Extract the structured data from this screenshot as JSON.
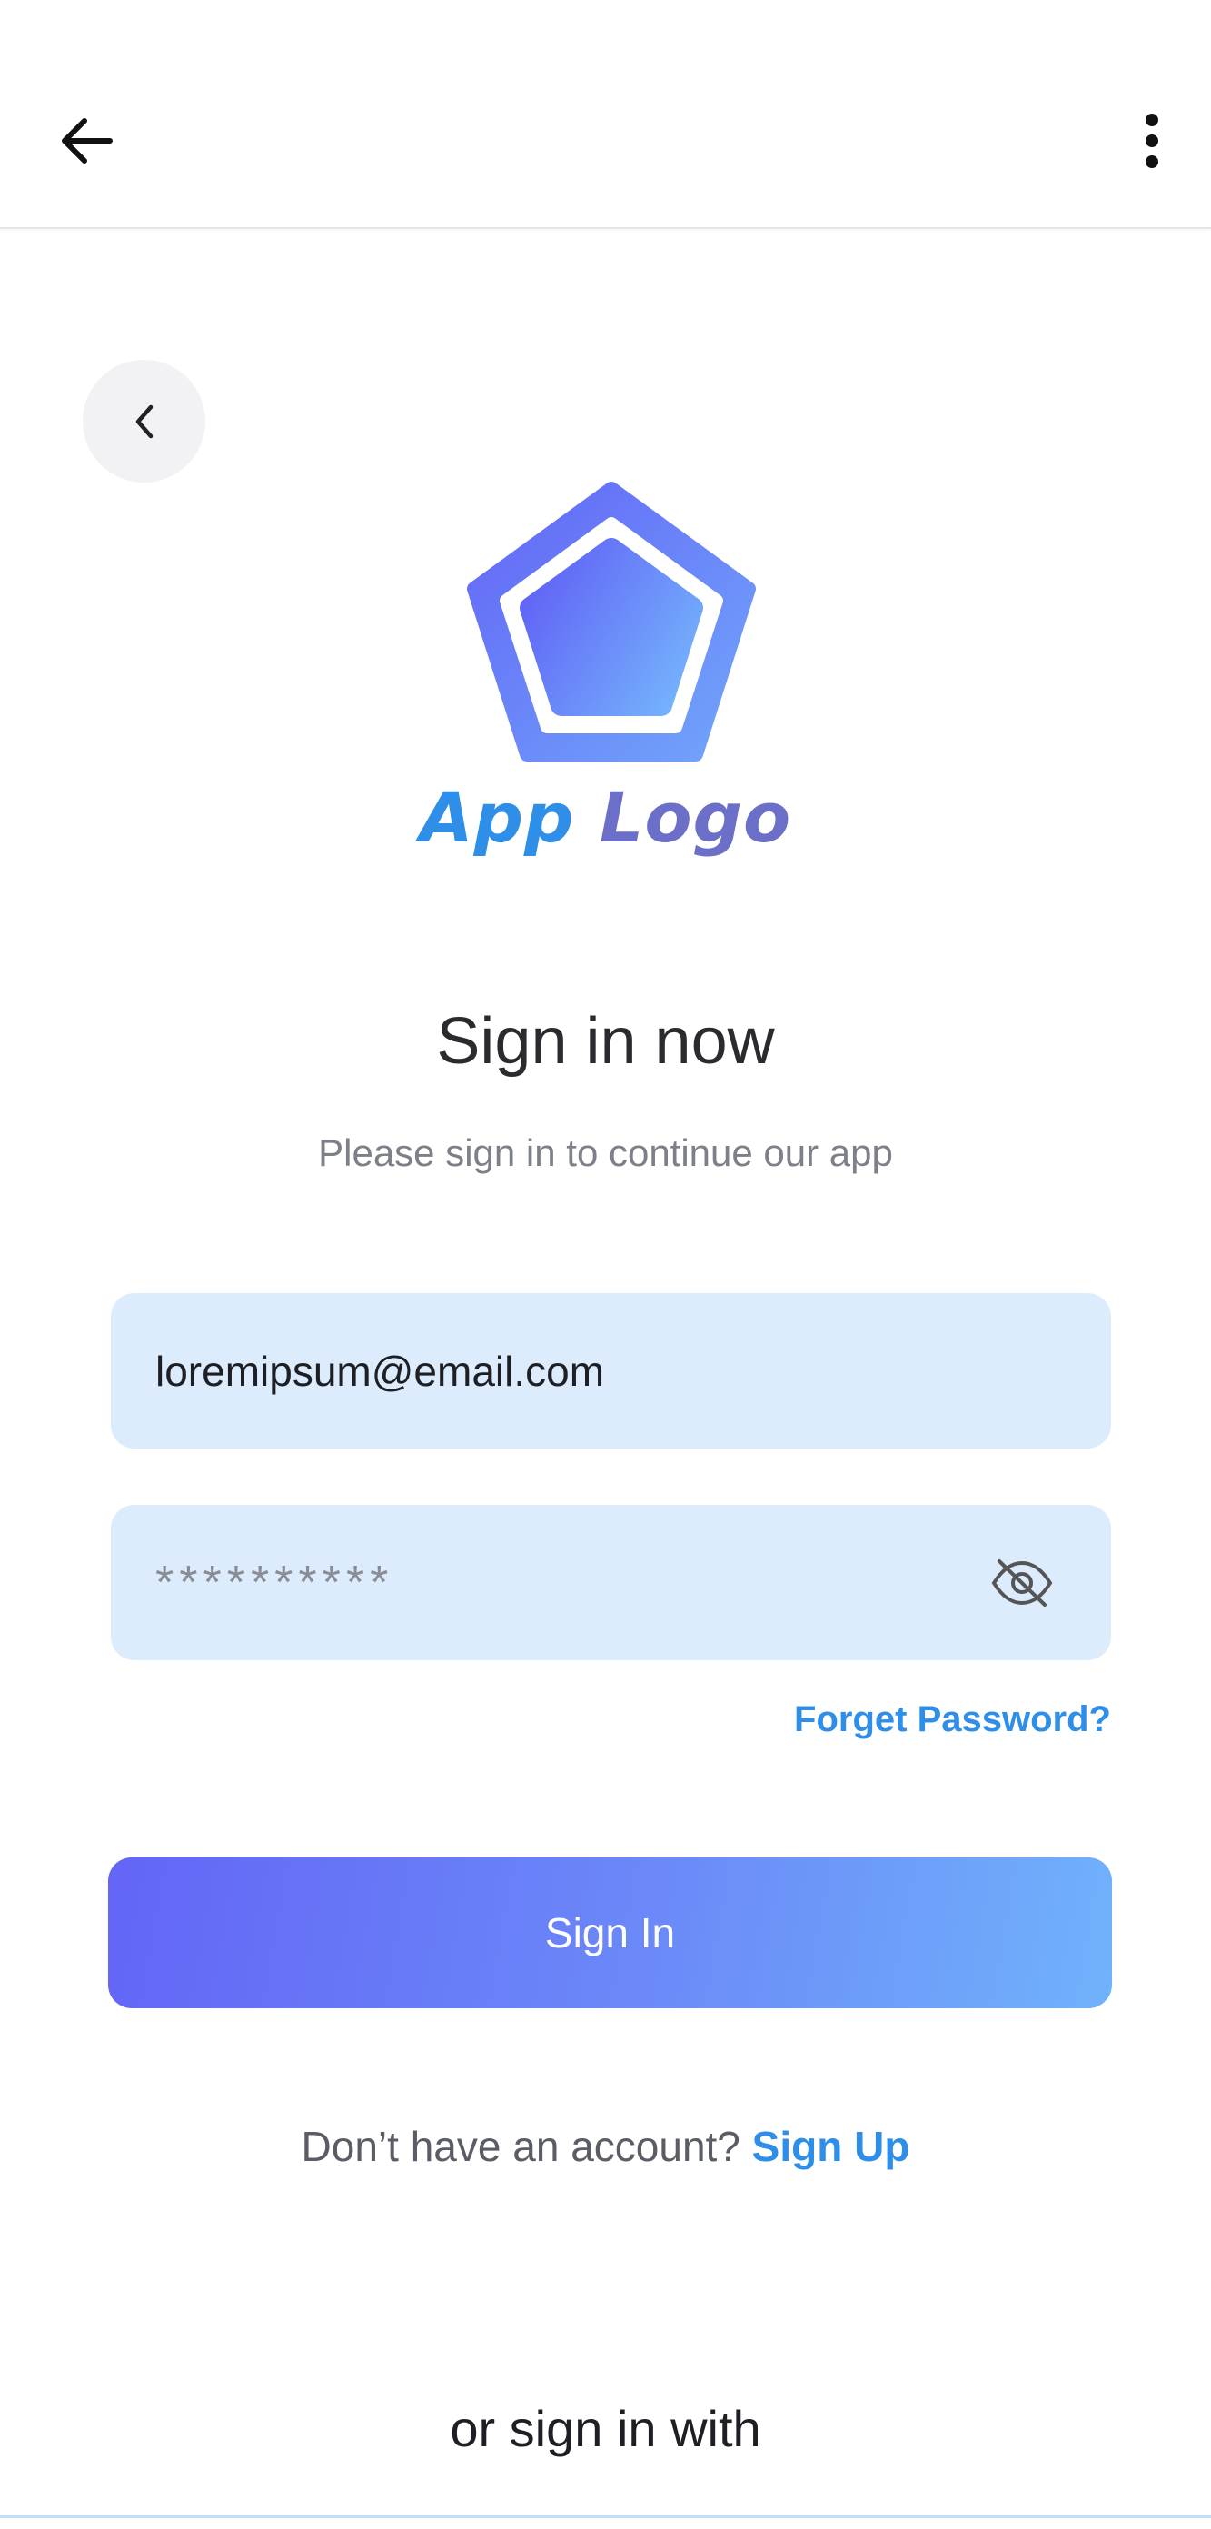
{
  "logo": {
    "word1": "App",
    "word2": "Logo"
  },
  "header": {
    "title": "Sign in now",
    "subtitle": "Please sign in to continue our app"
  },
  "form": {
    "email_value": "loremipsum@email.com",
    "password_value": "**********",
    "forget_label": "Forget Password?",
    "signin_label": "Sign In"
  },
  "signup": {
    "prompt": "Don’t have an account?",
    "link": "Sign Up"
  },
  "alt_signin": {
    "label": "or sign in with"
  },
  "icons": {
    "appbar_back": "arrow-left-icon",
    "appbar_menu": "more-vertical-icon",
    "circle_back": "chevron-left-icon",
    "password_toggle": "eye-off-icon"
  },
  "colors": {
    "accent": "#2f8fe8",
    "gradient_start": "#6365f6",
    "gradient_end": "#70b2fb",
    "field_bg": "#dcecfc"
  }
}
